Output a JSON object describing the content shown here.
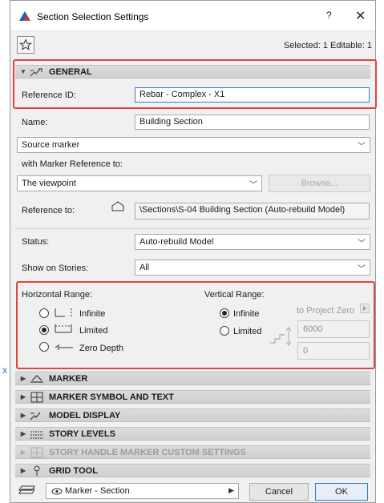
{
  "window": {
    "title": "Section Selection Settings",
    "help": "?",
    "close": "✕"
  },
  "toolbar": {
    "selected_info": "Selected: 1 Editable: 1"
  },
  "general": {
    "header": "GENERAL",
    "reference_id_label": "Reference ID:",
    "reference_id_value": "Rebar - Complex - X1",
    "name_label": "Name:",
    "name_value": "Building Section",
    "source_marker": "Source marker",
    "marker_ref_label": "with Marker Reference to:",
    "marker_ref_value": "The viewpoint",
    "browse_label": "Browse...",
    "reference_to_label": "Reference to:",
    "reference_to_value": "\\Sections\\S-04 Building Section (Auto-rebuild Model)",
    "status_label": "Status:",
    "status_value": "Auto-rebuild Model",
    "stories_label": "Show on Stories:",
    "stories_value": "All"
  },
  "ranges": {
    "horizontal_label": "Horizontal Range:",
    "h_options": [
      "Infinite",
      "Limited",
      "Zero Depth"
    ],
    "h_selected": "Limited",
    "vertical_label": "Vertical Range:",
    "v_options": [
      "Infinite",
      "Limited"
    ],
    "v_selected": "Infinite",
    "to_project_zero": "to Project Zero",
    "top_value": "6000",
    "bottom_value": "0"
  },
  "panels": [
    {
      "label": "MARKER",
      "disabled": false
    },
    {
      "label": "MARKER SYMBOL AND TEXT",
      "disabled": false
    },
    {
      "label": "MODEL DISPLAY",
      "disabled": false
    },
    {
      "label": "STORY LEVELS",
      "disabled": false
    },
    {
      "label": "STORY HANDLE MARKER CUSTOM SETTINGS",
      "disabled": true
    },
    {
      "label": "GRID TOOL",
      "disabled": false
    }
  ],
  "footer": {
    "layer_value": "Marker - Section",
    "cancel_label": "Cancel",
    "ok_label": "OK"
  },
  "colors": {
    "highlight": "#e0443a",
    "accent": "#2e7bd6"
  }
}
